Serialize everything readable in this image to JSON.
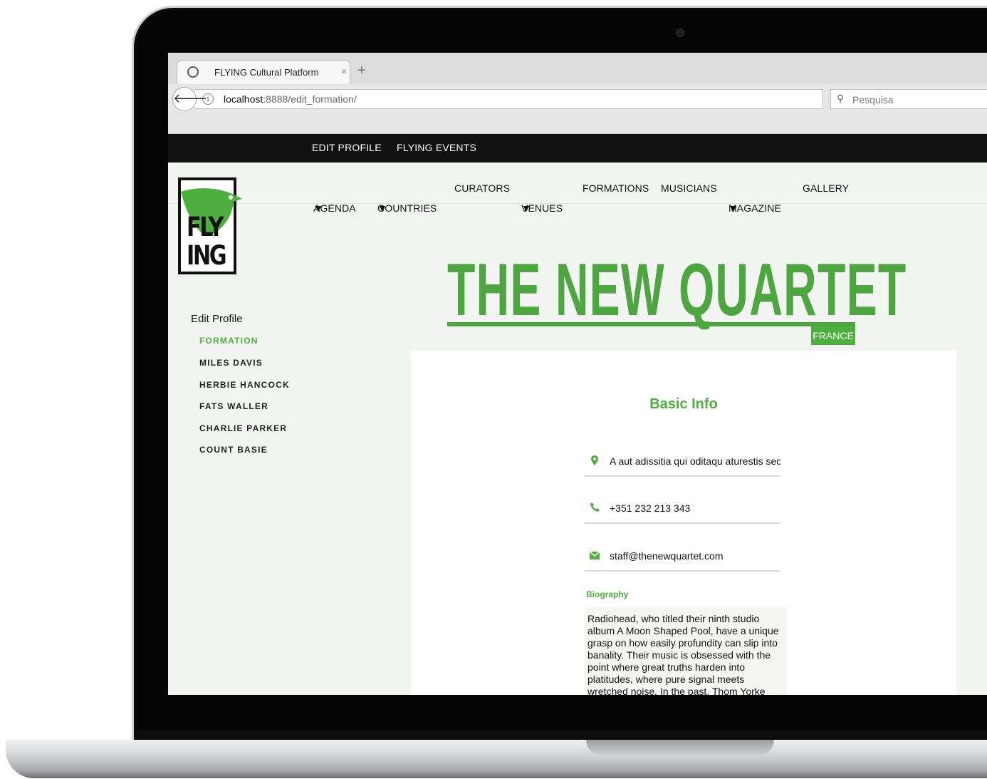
{
  "browser": {
    "tab_title": "FLYING Cultural Platform",
    "tab_close": "×",
    "new_tab": "+",
    "back_glyph": "🡐",
    "info_glyph": "i",
    "url_host": "localhost",
    "url_path": ":8888/edit_formation/",
    "reload_glyph": "↻",
    "search_placeholder": "Pesquisa",
    "search_glyph": "⚲"
  },
  "topbar": {
    "edit_profile": "EDIT PROFILE",
    "flying_events": "FLYING EVENTS"
  },
  "nav": {
    "agenda": "AGENDA",
    "countries": "COUNTRIES",
    "curators": "CURATORS",
    "venues": "VENUES",
    "formations": "FORMATIONS",
    "musicians": "MUSICIANS",
    "magazine": "MAGAZINE",
    "gallery": "GALLERY",
    "caret": "▼"
  },
  "logo": {
    "line1": "FLY",
    "line2": "ING",
    "bird_color": "#4caf3e"
  },
  "sidebar": {
    "title": "Edit Profile",
    "items": [
      {
        "label": "FORMATION",
        "active": true
      },
      {
        "label": "MILES DAVIS",
        "active": false
      },
      {
        "label": "HERBIE HANCOCK",
        "active": false
      },
      {
        "label": "FATS WALLER",
        "active": false
      },
      {
        "label": "CHARLIE PARKER",
        "active": false
      },
      {
        "label": "COUNT BASIE",
        "active": false
      }
    ]
  },
  "hero": {
    "title": "THE NEW QUARTET",
    "country": "FRANCE"
  },
  "card": {
    "title": "Basic Info",
    "address": "A aut adissitia qui oditaqu aturestis sec",
    "phone": "+351 232 213 343",
    "email": "staff@thenewquartet.com",
    "biography_label": "Biography",
    "biography": "Radiohead, who titled their ninth studio album A Moon Shaped Pool, have a unique grasp on how easily profundity can slip into banality. Their music is obsessed with the point where great truths harden into platitudes, where pure signal meets wretched noise. In the past, Thom Yorke"
  },
  "colors": {
    "accent": "#4caf3e",
    "topbar": "#111111",
    "page_bg": "#f2f5f1"
  }
}
